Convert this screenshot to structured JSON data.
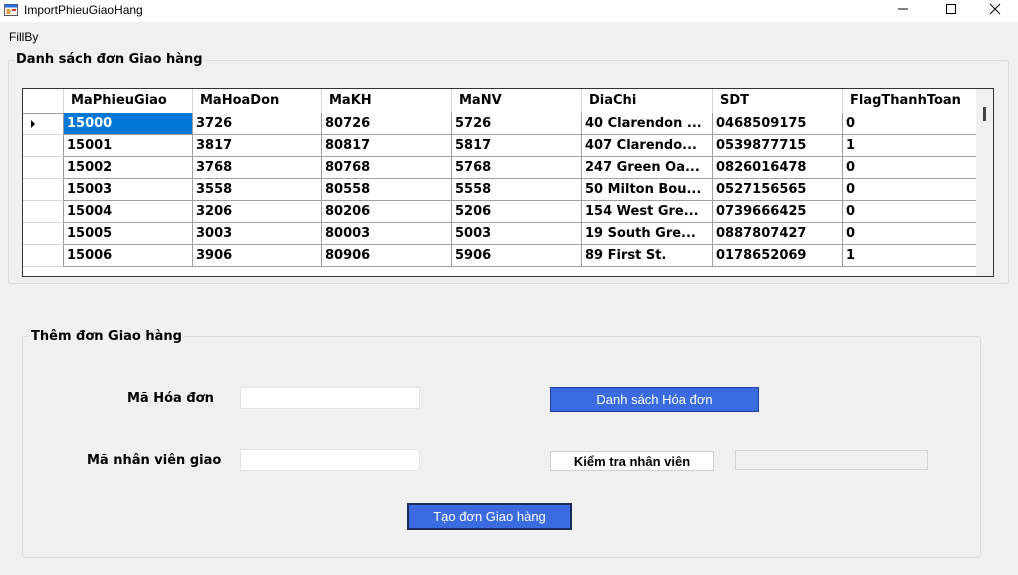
{
  "window": {
    "title": "ImportPhieuGiaoHang"
  },
  "menu": {
    "items": [
      "FillBy"
    ]
  },
  "list_group": {
    "title": "Danh sách đơn Giao hàng"
  },
  "grid": {
    "columns": [
      "MaPhieuGiao",
      "MaHoaDon",
      "MaKH",
      "MaNV",
      "DiaChi",
      "SDT",
      "FlagThanhToan"
    ],
    "rows": [
      [
        "15000",
        "3726",
        "80726",
        "5726",
        "40 Clarendon ...",
        "0468509175",
        "0"
      ],
      [
        "15001",
        "3817",
        "80817",
        "5817",
        "407 Clarendo...",
        "0539877715",
        "1"
      ],
      [
        "15002",
        "3768",
        "80768",
        "5768",
        "247 Green Oa...",
        "0826016478",
        "0"
      ],
      [
        "15003",
        "3558",
        "80558",
        "5558",
        "50 Milton Bou...",
        "0527156565",
        "0"
      ],
      [
        "15004",
        "3206",
        "80206",
        "5206",
        "154 West Gre...",
        "0739666425",
        "0"
      ],
      [
        "15005",
        "3003",
        "80003",
        "5003",
        "19 South Gre...",
        "0887807427",
        "0"
      ],
      [
        "15006",
        "3906",
        "80906",
        "5906",
        "89 First St.",
        "0178652069",
        "1"
      ]
    ],
    "selected_row": 0
  },
  "add_group": {
    "title": "Thêm đơn Giao hàng",
    "invoice_label": "Mã Hóa đơn",
    "invoice_value": "",
    "invoice_list_button": "Danh sách Hóa đơn",
    "employee_label": "Mã nhân viên giao",
    "employee_value": "",
    "check_employee_button": "Kiểm tra nhân viên",
    "check_result": "",
    "create_button": "Tạo đơn Giao hàng"
  },
  "icons": {
    "app": "form-icon",
    "minimize": "minimize-icon",
    "maximize": "maximize-icon",
    "close": "close-icon",
    "row_indicator": "current-row-arrow-icon"
  },
  "colors": {
    "accent_button": "#3a6ce0",
    "selected_cell": "#0078d7"
  }
}
